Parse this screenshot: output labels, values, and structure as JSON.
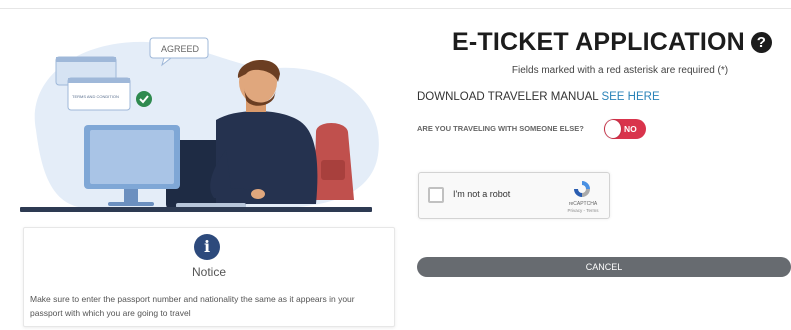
{
  "illustration": {
    "agreed_bubble": "AGREED",
    "terms_card": "TERMS AND CONDITION"
  },
  "notice": {
    "icon": "info-icon",
    "title": "Notice",
    "message": "Make sure to enter the passport number and nationality the same as it appears in your passport with which you are going to travel"
  },
  "form": {
    "title": "E-TICKET APPLICATION",
    "help_icon": "question-circle-icon",
    "required_note": "Fields marked with a red asterisk are required (*)",
    "download_label": "DOWNLOAD TRAVELER MANUAL",
    "download_link": "SEE HERE",
    "traveling_question": "ARE YOU TRAVELING WITH SOMEONE ELSE?",
    "traveling_toggle": "NO",
    "toggle_color": "#d9344c",
    "cancel_label": "CANCEL"
  },
  "captcha": {
    "label": "I'm not a robot",
    "brand": "reCAPTCHA",
    "terms": "Privacy - Terms"
  }
}
